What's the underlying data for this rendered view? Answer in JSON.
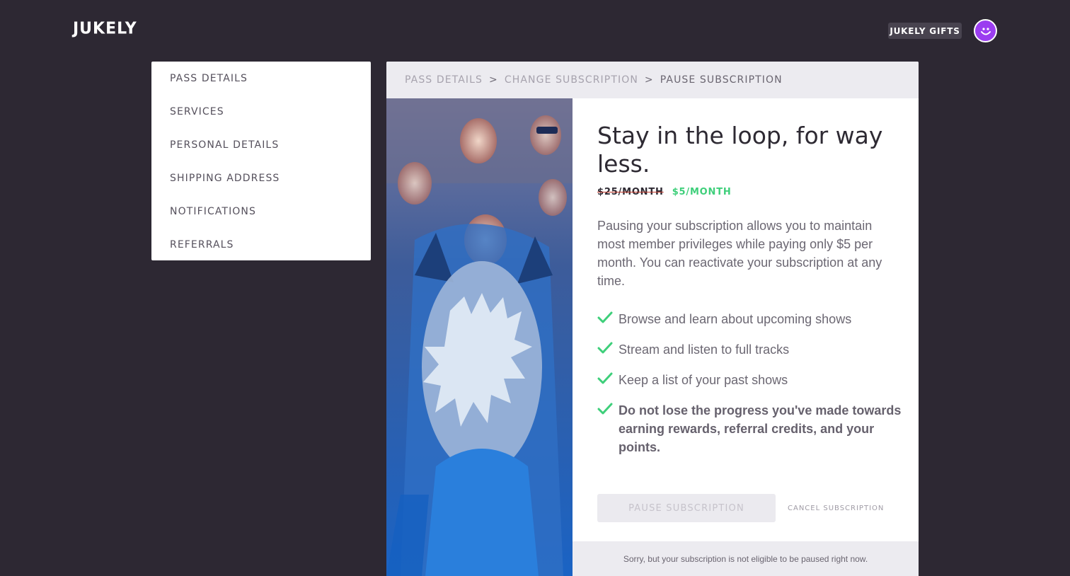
{
  "header": {
    "logo": "JUKELY",
    "gifts_label": "JUKELY GIFTS",
    "avatar_icon": "smiley-face-icon",
    "avatar_color": "#9b3df0"
  },
  "sidebar": {
    "items": [
      {
        "label": "PASS DETAILS"
      },
      {
        "label": "SERVICES"
      },
      {
        "label": "PERSONAL DETAILS"
      },
      {
        "label": "SHIPPING ADDRESS"
      },
      {
        "label": "NOTIFICATIONS"
      },
      {
        "label": "REFERRALS"
      }
    ]
  },
  "breadcrumb": {
    "items": [
      "PASS DETAILS",
      "CHANGE SUBSCRIPTION",
      "PAUSE SUBSCRIPTION"
    ],
    "separator": ">"
  },
  "main": {
    "headline": "Stay in the loop, for way less.",
    "old_price": "$25/MONTH",
    "new_price": "$5/MONTH",
    "description": "Pausing your subscription allows you to maintain most member privileges while paying only $5 per month. You can reactivate your subscription at any time.",
    "benefits": [
      {
        "text": "Browse and learn about upcoming shows",
        "icon": "check-icon"
      },
      {
        "text": "Stream and listen to full tracks",
        "icon": "check-icon"
      },
      {
        "text": "Keep a list of your past shows",
        "icon": "check-icon"
      },
      {
        "text": "Do not lose the progress you've made towards earning rewards, referral credits, and your points.",
        "icon": "check-icon"
      }
    ],
    "pause_button": "PAUSE SUBSCRIPTION",
    "cancel_link": "CANCEL SUBSCRIPTION",
    "notice": "Sorry, but your subscription is not eligible to be paused right now."
  },
  "colors": {
    "background": "#2d2833",
    "accent_green": "#3ecf7a",
    "strike_red": "#c0392b"
  }
}
